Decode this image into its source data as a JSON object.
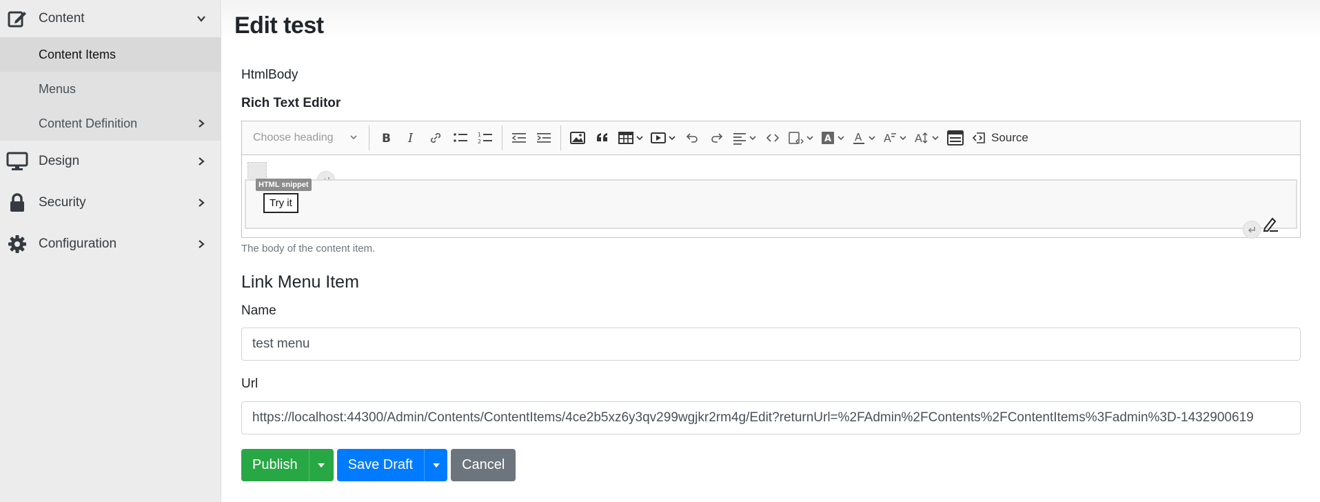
{
  "sidebar": {
    "groups": [
      {
        "label": "Content",
        "icon": "edit-icon"
      },
      {
        "label": "Design",
        "icon": "monitor-icon"
      },
      {
        "label": "Security",
        "icon": "lock-icon"
      },
      {
        "label": "Configuration",
        "icon": "gear-icon"
      }
    ],
    "content_items": [
      {
        "label": "Content Items"
      },
      {
        "label": "Menus"
      },
      {
        "label": "Content Definition"
      }
    ]
  },
  "page": {
    "title": "Edit test"
  },
  "html_body": {
    "label": "HtmlBody",
    "editor_label": "Rich Text Editor",
    "toolbar": {
      "heading_placeholder": "Choose heading",
      "source_label": "Source"
    },
    "widget": {
      "badge": "HTML snippet",
      "button_text": "Try it"
    },
    "hint": "The body of the content item."
  },
  "link_menu_item": {
    "title": "Link Menu Item",
    "name_label": "Name",
    "name_value": "test menu",
    "url_label": "Url",
    "url_value": "https://localhost:44300/Admin/Contents/ContentItems/4ce2b5xz6y3qv299wgjkr2rm4g/Edit?returnUrl=%2FAdmin%2FContents%2FContentItems%3Fadmin%3D-1432900619"
  },
  "actions": {
    "publish": "Publish",
    "save_draft": "Save Draft",
    "cancel": "Cancel"
  },
  "colors": {
    "publish": "#28a745",
    "save_draft": "#007bff",
    "cancel": "#6c757d",
    "sidebar_bg": "#ececec"
  }
}
